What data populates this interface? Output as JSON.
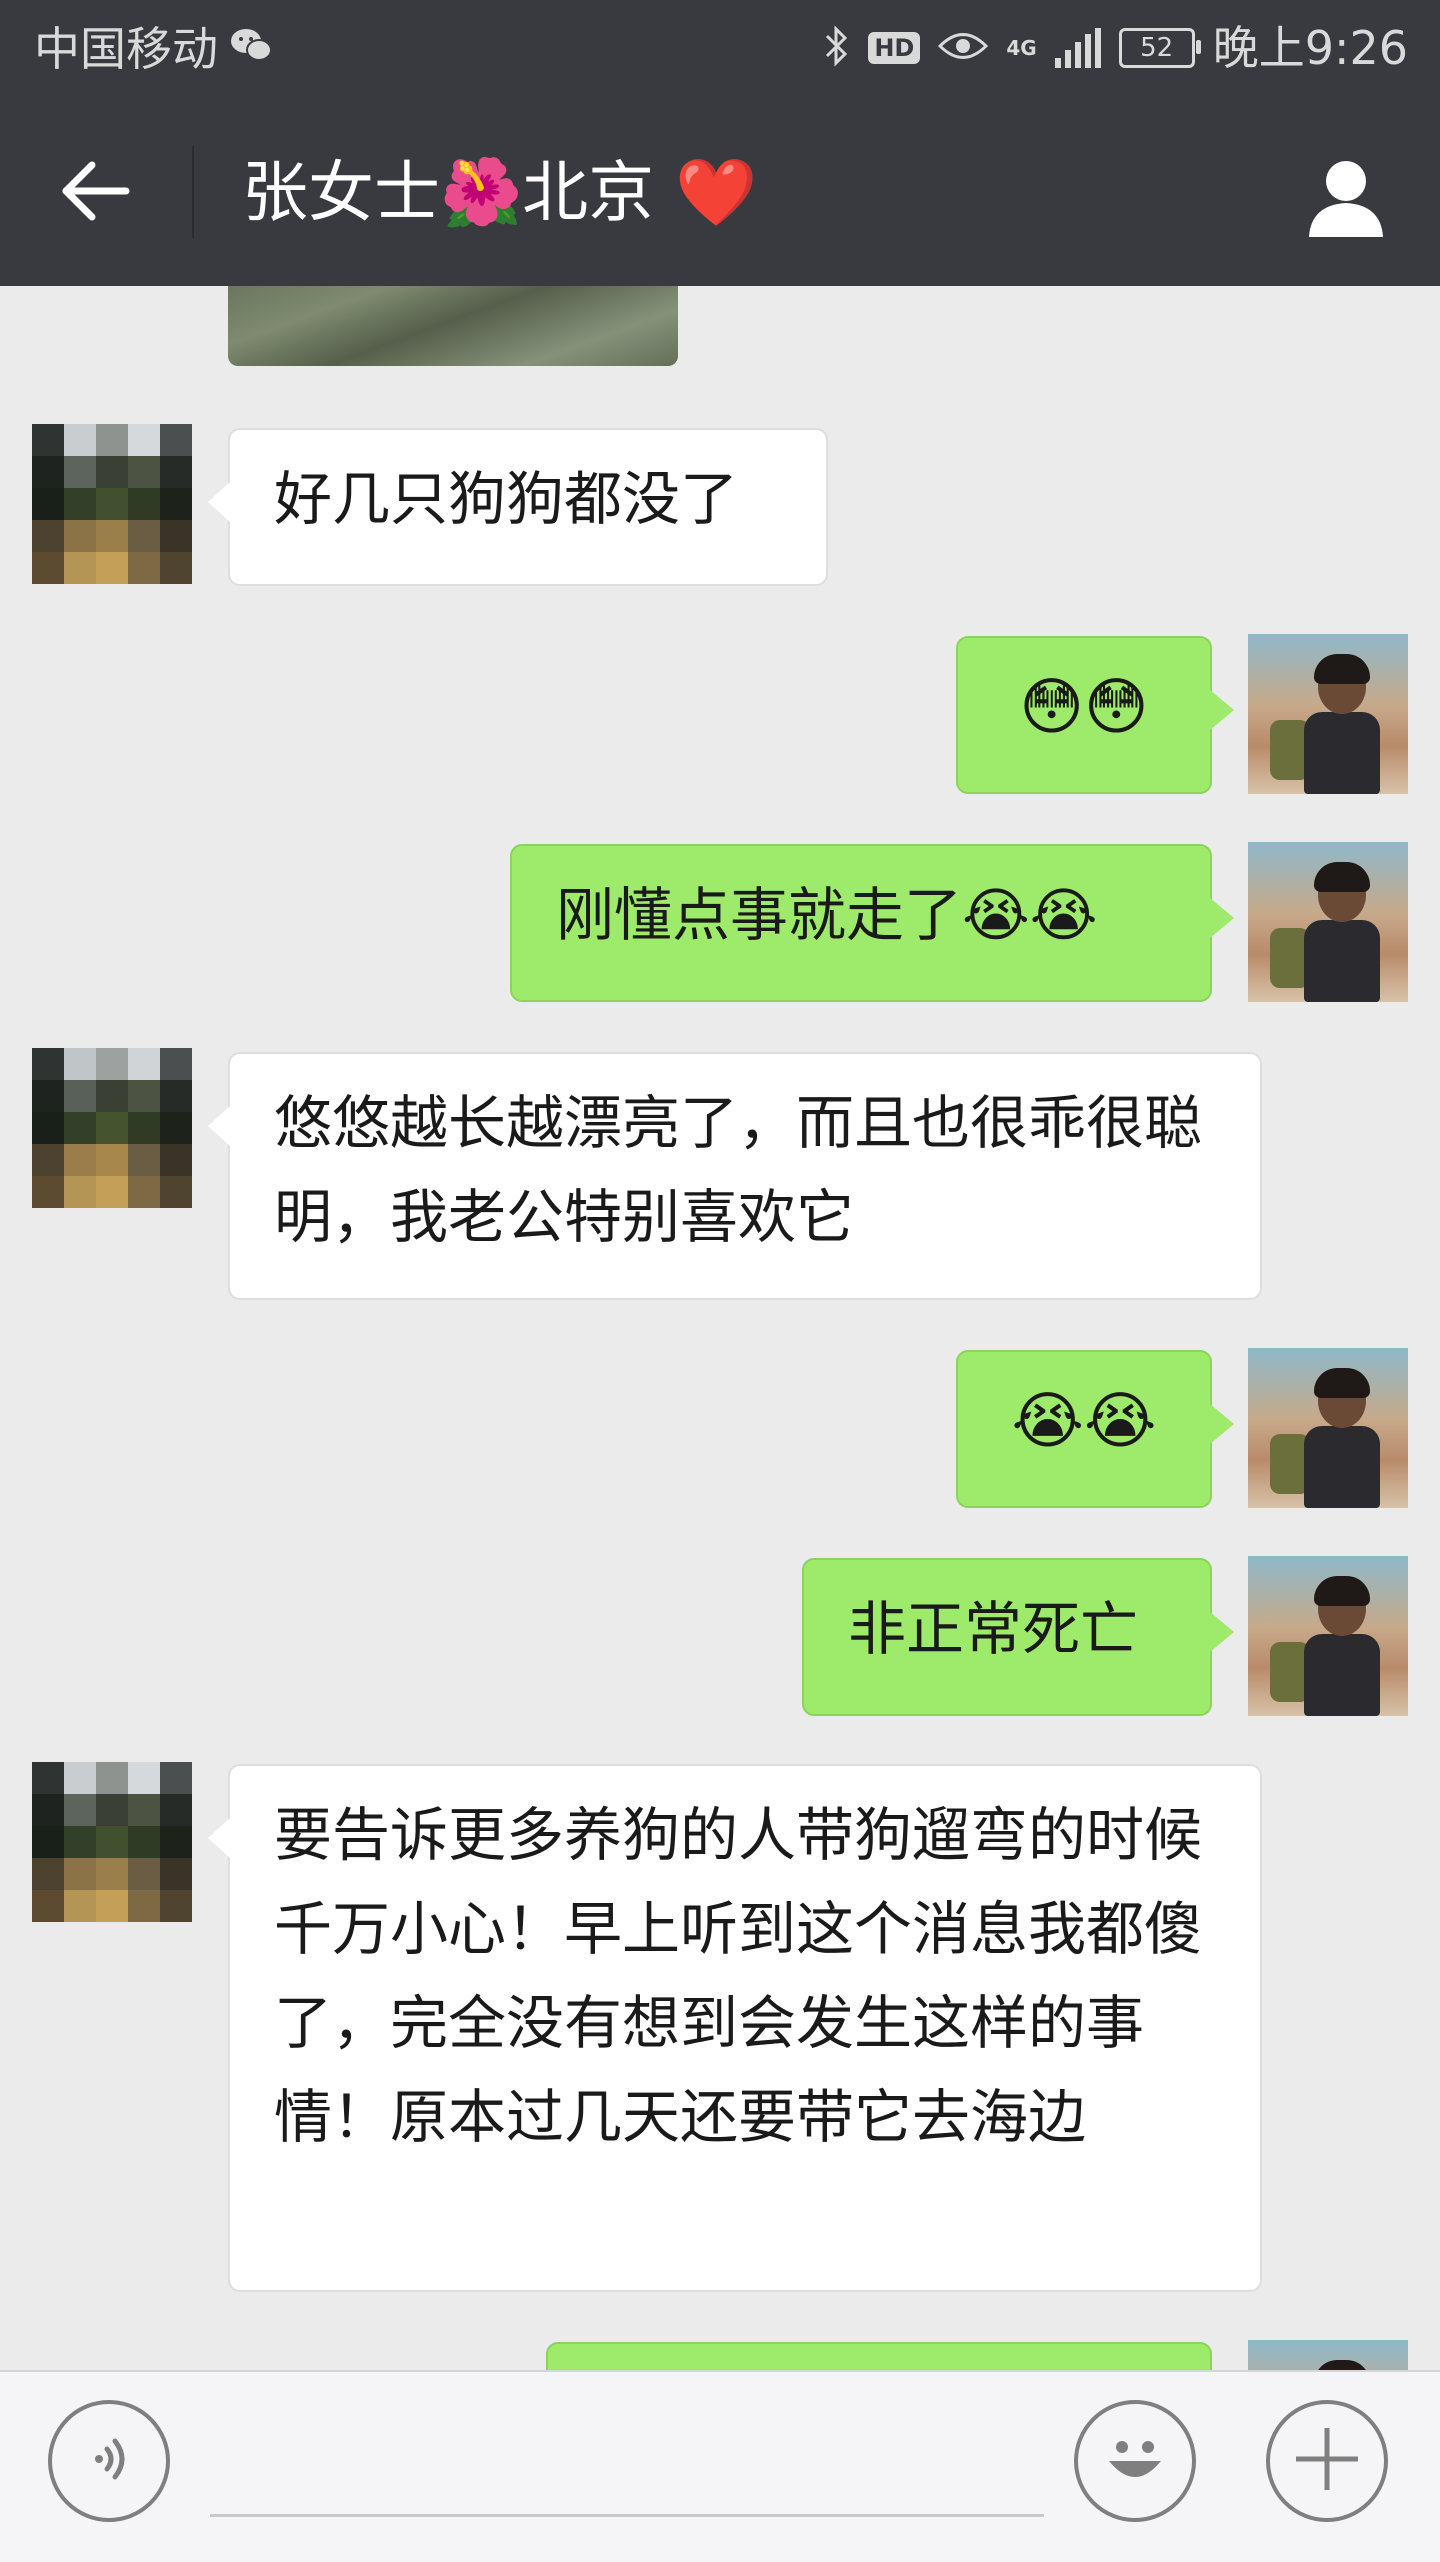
{
  "status_bar": {
    "carrier": "中国移动",
    "network": "4G",
    "battery": "52",
    "time": "晚上9:26",
    "hd_badge": "HD"
  },
  "nav": {
    "title": "张女士🌺北京 ❤️",
    "back_icon": "arrow-left-icon",
    "profile_icon": "person-icon"
  },
  "messages": [
    {
      "side": "left",
      "type": "image"
    },
    {
      "side": "left",
      "type": "text",
      "text": "好几只狗狗都没了"
    },
    {
      "side": "right",
      "type": "text",
      "text": "😳😳"
    },
    {
      "side": "right",
      "type": "text",
      "text": "刚懂点事就走了😭😭"
    },
    {
      "side": "left",
      "type": "text",
      "text": "悠悠越长越漂亮了，而且也很乖很聪明，我老公特别喜欢它"
    },
    {
      "side": "right",
      "type": "text",
      "text": "😭😭"
    },
    {
      "side": "right",
      "type": "text",
      "text": "非正常死亡"
    },
    {
      "side": "left",
      "type": "text",
      "text": "要告诉更多养狗的人带狗遛弯的时候千万小心！早上听到这个消息我都傻了，完全没有想到会发生这样的事情！原本过几天还要带它去海边"
    },
    {
      "side": "right",
      "type": "text",
      "text": ""
    }
  ],
  "input_bar": {
    "voice_icon": "voice-icon",
    "emoji_icon": "smiley-icon",
    "plus_icon": "plus-icon",
    "input_value": ""
  },
  "colors": {
    "header": "#393a3f",
    "chat_bg": "#ebebeb",
    "my_bubble": "#9eea6a",
    "their_bubble": "#ffffff"
  }
}
